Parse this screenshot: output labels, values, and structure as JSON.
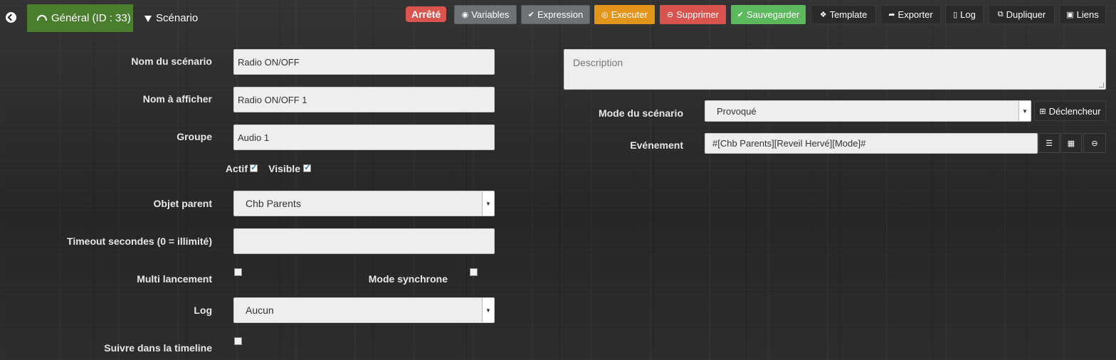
{
  "tabs": {
    "general": "Général (ID : 33)",
    "scenario": "Scénario"
  },
  "status": {
    "label": "Arrêté",
    "color": "#d9534f"
  },
  "toolbar": {
    "variables": "Variables",
    "expression": "Expression",
    "executer": "Executer",
    "supprimer": "Supprimer",
    "sauvegarder": "Sauvegarder",
    "template": "Template",
    "exporter": "Exporter",
    "log": "Log",
    "dupliquer": "Dupliquer",
    "liens": "Liens"
  },
  "form": {
    "nom_label": "Nom du scénario",
    "nom_value": "Radio ON/OFF",
    "afficher_label": "Nom à afficher",
    "afficher_value": "Radio ON/OFF 1",
    "groupe_label": "Groupe",
    "groupe_value": "Audio 1",
    "actif_label": "Actif",
    "visible_label": "Visible",
    "parent_label": "Objet parent",
    "parent_value": "Chb Parents",
    "timeout_label": "Timeout secondes (0 = illimité)",
    "timeout_value": "",
    "multi_label": "Multi lancement",
    "sync_label": "Mode synchrone",
    "log_label": "Log",
    "log_value": "Aucun",
    "timeline_label": "Suivre dans la timeline"
  },
  "right": {
    "description_placeholder": "Description",
    "mode_label": "Mode du scénario",
    "mode_value": "Provoqué",
    "declencheur": "Déclencheur",
    "event_label": "Evénement",
    "event_value": "#[Chb Parents][Reveil Hervé][Mode]#"
  },
  "checks": {
    "actif": true,
    "visible": true,
    "multi": false,
    "sync": false,
    "timeline": false
  },
  "colors": {
    "tab_active": "#4a7d2e",
    "orange": "#e2951a",
    "red": "#d9534f",
    "green": "#5cb85c",
    "grey": "#6f7275"
  }
}
